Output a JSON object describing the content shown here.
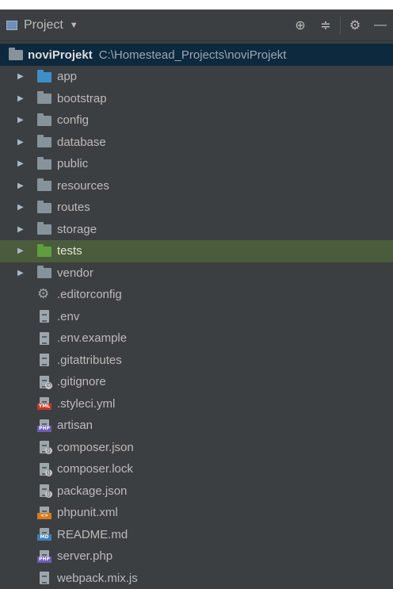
{
  "panel": {
    "title": "Project",
    "caret": "▼"
  },
  "toolbar": {
    "locate_icon": "⊕",
    "collapse_icon": "≑",
    "settings_icon": "⚙",
    "hide_icon": "—"
  },
  "root": {
    "name": "noviProjekt",
    "path": "C:\\Homestead_Projects\\noviProjekt"
  },
  "items": [
    {
      "label": "app",
      "kind": "folder",
      "color": "#3d8fc8"
    },
    {
      "label": "bootstrap",
      "kind": "folder",
      "color": "#87939a"
    },
    {
      "label": "config",
      "kind": "folder",
      "color": "#87939a"
    },
    {
      "label": "database",
      "kind": "folder",
      "color": "#87939a"
    },
    {
      "label": "public",
      "kind": "folder",
      "color": "#87939a"
    },
    {
      "label": "resources",
      "kind": "folder",
      "color": "#87939a"
    },
    {
      "label": "routes",
      "kind": "folder",
      "color": "#87939a"
    },
    {
      "label": "storage",
      "kind": "folder",
      "color": "#87939a"
    },
    {
      "label": "tests",
      "kind": "folder",
      "color": "#5f9e3f"
    },
    {
      "label": "vendor",
      "kind": "folder",
      "color": "#87939a"
    },
    {
      "label": ".editorconfig",
      "kind": "config-file"
    },
    {
      "label": ".env",
      "kind": "text-file"
    },
    {
      "label": ".env.example",
      "kind": "text-file"
    },
    {
      "label": ".gitattributes",
      "kind": "text-file"
    },
    {
      "label": ".gitignore",
      "kind": "gitignore-file"
    },
    {
      "label": ".styleci.yml",
      "kind": "yml-file",
      "tag": "YML"
    },
    {
      "label": "artisan",
      "kind": "php-file",
      "tag": "PHP"
    },
    {
      "label": "composer.json",
      "kind": "json-file"
    },
    {
      "label": "composer.lock",
      "kind": "json-file"
    },
    {
      "label": "package.json",
      "kind": "json-file"
    },
    {
      "label": "phpunit.xml",
      "kind": "xml-file",
      "tag": "<>"
    },
    {
      "label": "README.md",
      "kind": "md-file",
      "tag": "MD"
    },
    {
      "label": "server.php",
      "kind": "php-file",
      "tag": "PHP"
    },
    {
      "label": "webpack.mix.js",
      "kind": "js-file"
    }
  ]
}
